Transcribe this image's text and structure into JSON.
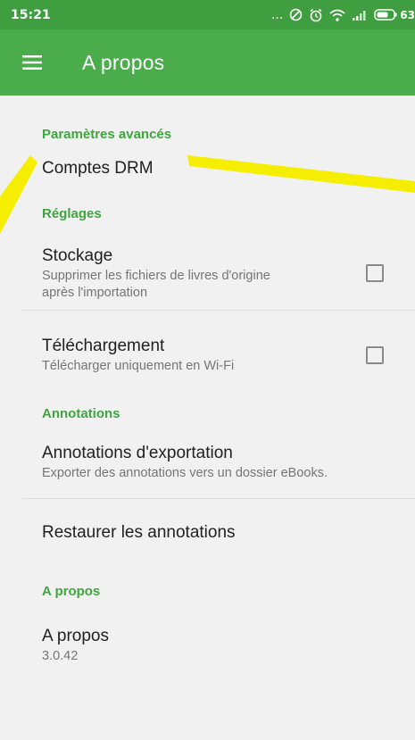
{
  "status_bar": {
    "time": "15:21",
    "more": "...",
    "battery_pct": "63"
  },
  "app_bar": {
    "title": "A propos",
    "menu_icon": "hamburger-menu-icon"
  },
  "sections": {
    "advanced": {
      "header": "Paramètres avancés",
      "drm": {
        "title": "Comptes DRM"
      }
    },
    "settings": {
      "header": "Réglages",
      "storage": {
        "title": "Stockage",
        "subtitle_line1": "Supprimer les fichiers de livres d'origine",
        "subtitle_line2": "après l'importation",
        "checked": false
      },
      "download": {
        "title": "Téléchargement",
        "subtitle": "Télécharger uniquement en Wi-Fi",
        "checked": false
      }
    },
    "annotations": {
      "header": "Annotations",
      "export": {
        "title": "Annotations d'exportation",
        "subtitle": "Exporter des annotations vers un dossier eBooks."
      },
      "restore": {
        "title": "Restaurer les annotations"
      }
    },
    "about": {
      "header": "A propos",
      "about": {
        "title": "A propos",
        "subtitle": "3.0.42"
      }
    }
  },
  "colors": {
    "status_bar": "#3f9e3f",
    "app_bar": "#4aac4a",
    "section_header": "#3fa63f",
    "background": "#f1f1f1",
    "annotation": "#f5ee00"
  }
}
